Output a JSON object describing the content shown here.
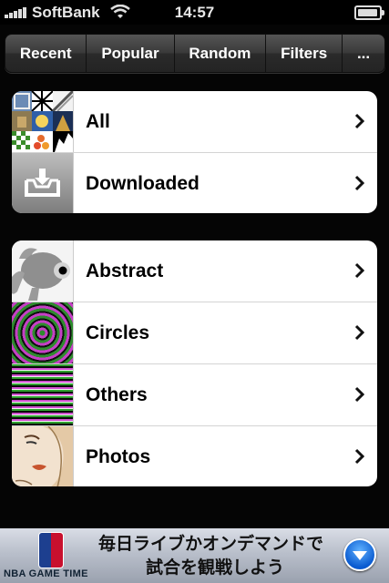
{
  "status_bar": {
    "carrier": "SoftBank",
    "time": "14:57"
  },
  "tabs": [
    {
      "label": "Recent"
    },
    {
      "label": "Popular"
    },
    {
      "label": "Random"
    },
    {
      "label": "Filters"
    },
    {
      "label": "..."
    }
  ],
  "groups": [
    {
      "rows": [
        {
          "label": "All"
        },
        {
          "label": "Downloaded"
        }
      ]
    },
    {
      "rows": [
        {
          "label": "Abstract"
        },
        {
          "label": "Circles"
        },
        {
          "label": "Others"
        },
        {
          "label": "Photos"
        }
      ]
    }
  ],
  "ad": {
    "brand": "NBA GAME TIME",
    "line1": "毎日ライブかオンデマンドで",
    "line2": "試合を観戦しよう"
  }
}
